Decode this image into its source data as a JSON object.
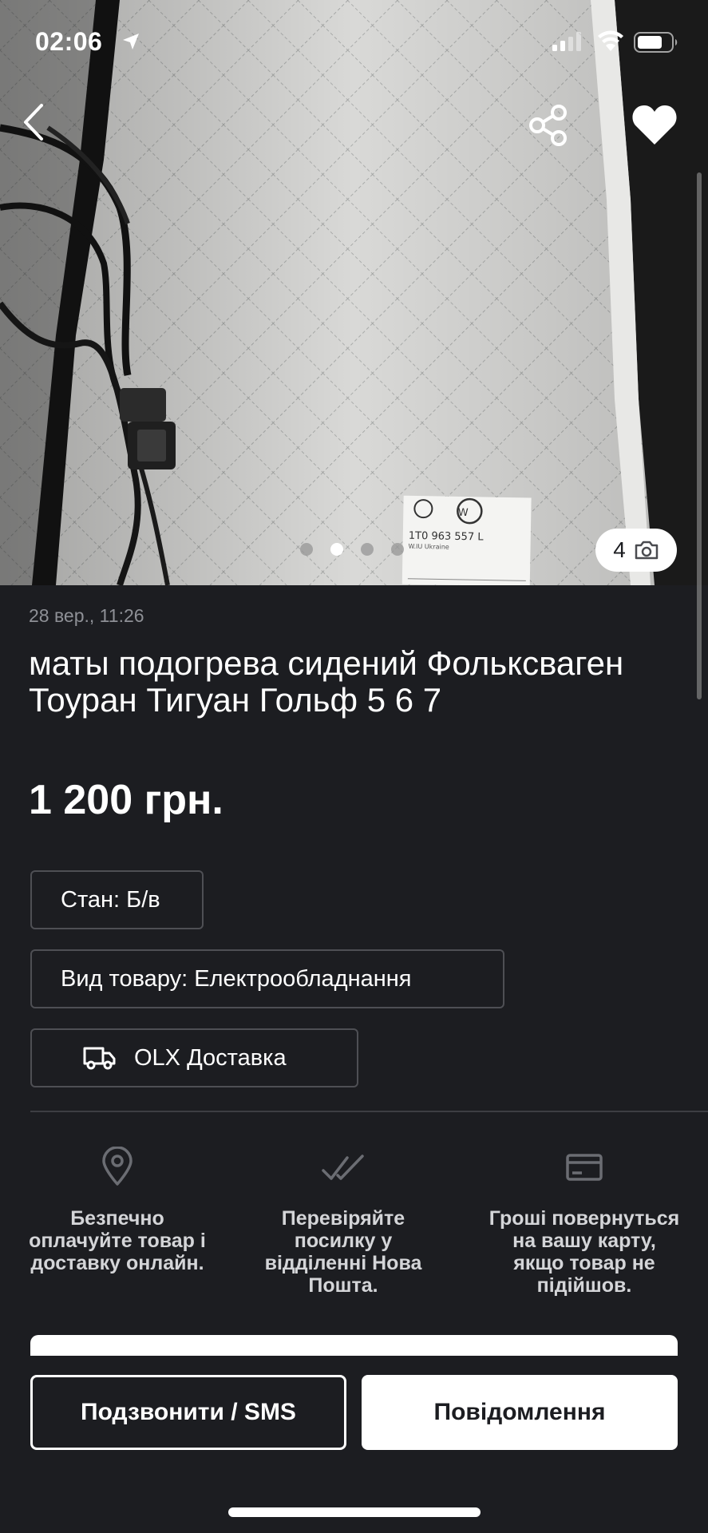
{
  "status_bar": {
    "time": "02:06"
  },
  "photo": {
    "label_code": "1T0 963 557 L",
    "label_origin": "W.IU Ukraine",
    "pager_count": 4,
    "active_index": 1,
    "photo_count": "4"
  },
  "ad": {
    "date": "28 вер., 11:26",
    "title": "маты подогрева сидений Фольксваген Тоуран Тигуан Гольф 5 6 7",
    "price": "1 200 грн."
  },
  "tags": {
    "condition": "Стан: Б/в",
    "type": "Вид товару: Електрообладнання",
    "delivery": "OLX Доставка"
  },
  "features": [
    {
      "icon": "location-pin-icon",
      "text": "Безпечно оплачуйте товар і доставку онлайн."
    },
    {
      "icon": "double-check-icon",
      "text": "Перевіряйте посилку у відділенні Нова Пошта."
    },
    {
      "icon": "credit-card-icon",
      "text": "Гроші повернуться на вашу карту, якщо товар не підійшов."
    }
  ],
  "actions": {
    "call_label": "Подзвонити / SMS",
    "message_label": "Повідомлення"
  },
  "colors": {
    "background": "#1c1d21",
    "text": "#ffffff",
    "muted": "#8e9096",
    "border": "#4e4f54"
  }
}
